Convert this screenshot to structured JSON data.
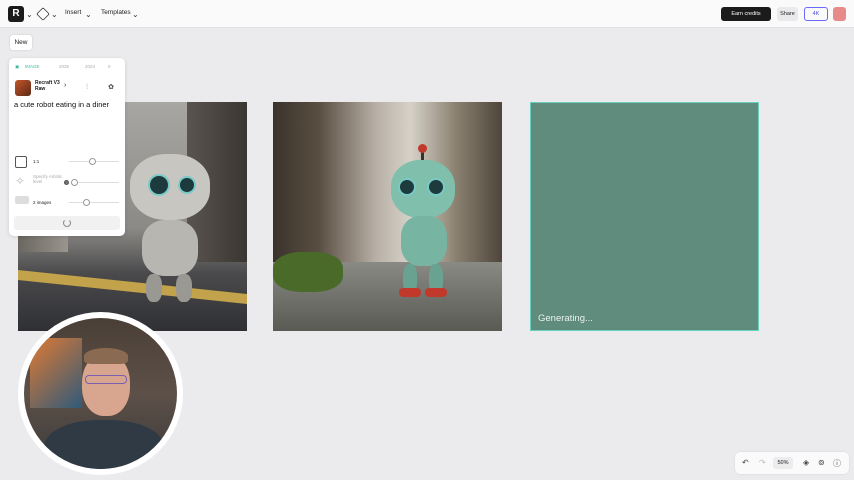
{
  "topbar": {
    "logo_glyph": "R",
    "menus": [
      {
        "label": "Insert"
      },
      {
        "label": "Templates"
      }
    ],
    "earn_credits": "Earn credits",
    "share": "Share",
    "upgrade": "4K"
  },
  "new_label": "New",
  "panel": {
    "tabs": [
      "IMAGE",
      "2026",
      "2024",
      "0"
    ],
    "model": "Recraft V3 Raw",
    "prompt": "a cute robot eating in a diner",
    "ratio": "1:1",
    "artistic_label": "Specify Artistic level",
    "images_count": "2 images"
  },
  "canvas": {
    "status": "Generating..."
  },
  "bottombar": {
    "zoom": "50%"
  },
  "colors": {
    "accent": "#3db79f",
    "generating_bg": "#5f8c7c",
    "upgrade": "#5050e0"
  },
  "icons": [
    "logo-icon",
    "chevron-down-icon",
    "vector-tool-icon",
    "sliders-icon",
    "palette-icon",
    "aspect-ratio-icon",
    "sparkle-icon",
    "images-icon",
    "undo-icon",
    "redo-icon",
    "layers-icon",
    "library-icon",
    "help-icon"
  ]
}
